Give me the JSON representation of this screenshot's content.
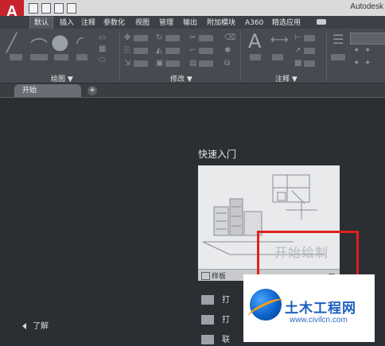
{
  "window": {
    "title_partial": "Autodesk",
    "logo_letter": "A"
  },
  "ribbon": {
    "tabs": [
      "默认",
      "插入",
      "注释",
      "参数化",
      "视图",
      "管理",
      "输出",
      "附加模块",
      "A360",
      "精选应用"
    ],
    "active_tab": "默认",
    "panels": [
      "绘图",
      "修改",
      "注释"
    ],
    "dropdown_glyph": "▼"
  },
  "file_tabs": {
    "start": "开始",
    "add": "+"
  },
  "start_page": {
    "heading": "快速入门",
    "template_footer": "样板",
    "start_drawing": "开始绘制",
    "actions": [
      "打",
      "打",
      "联"
    ],
    "learn": "了解"
  },
  "watermark": {
    "title": "土木工程网",
    "url": "www.civilcn.com"
  },
  "colors": {
    "accent_red": "#e0211b",
    "logo_red": "#c8232c",
    "bg": "#2b2e33"
  },
  "icons": [
    "autocad-logo-icon",
    "new-file-icon",
    "open-folder-icon",
    "save-icon",
    "print-icon",
    "plus-icon",
    "folder-icon",
    "sheet-set-icon",
    "connect-icon",
    "back-arrow-icon"
  ]
}
